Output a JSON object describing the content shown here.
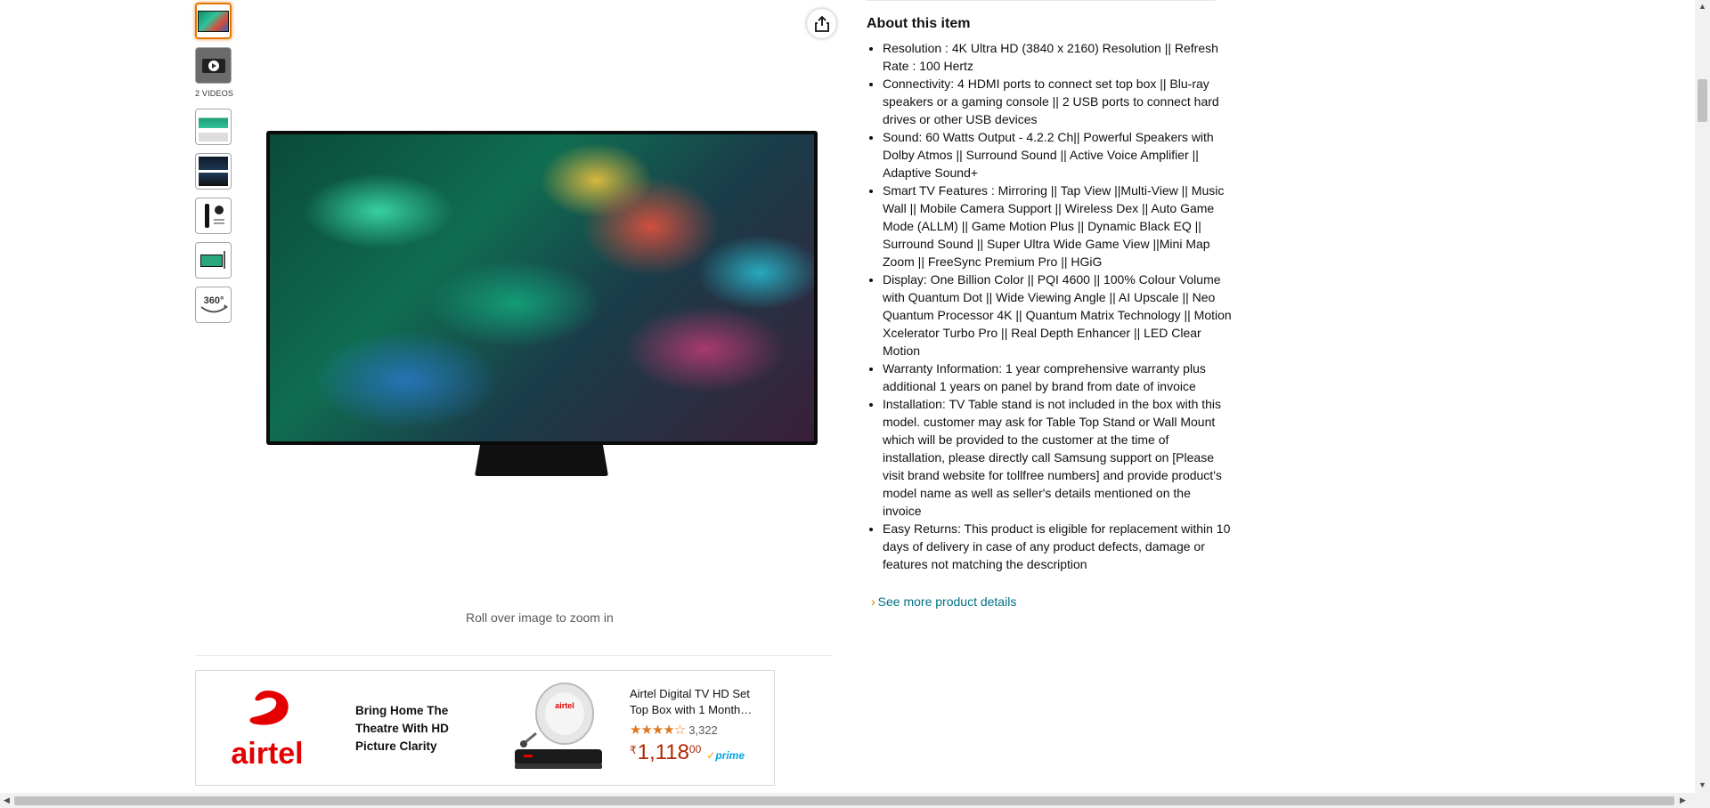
{
  "gallery": {
    "videos_label": "2 VIDEOS",
    "thumbnails": [
      "tv-front",
      "video",
      "tv-infographic",
      "tv-features",
      "remote-and-accessory",
      "tv-stand",
      "360-view"
    ],
    "thumb_360_label": "360°",
    "zoom_hint": "Roll over image to zoom in"
  },
  "about": {
    "title": "About this item",
    "bullets": [
      "Resolution : 4K Ultra HD (3840 x 2160) Resolution || Refresh Rate : 100 Hertz",
      "Connectivity: 4 HDMI ports to connect set top box || Blu-ray speakers or a gaming console || 2 USB ports to connect hard drives or other USB devices",
      "Sound: 60 Watts Output - 4.2.2 Ch|| Powerful Speakers with Dolby Atmos || Surround Sound || Active Voice Amplifier || Adaptive Sound+",
      "Smart TV Features : Mirroring || Tap View ||Multi-View || Music Wall || Mobile Camera Support || Wireless Dex || Auto Game Mode (ALLM) || Game Motion Plus || Dynamic Black EQ || Surround Sound || Super Ultra Wide Game View ||Mini Map Zoom || FreeSync Premium Pro || HGiG",
      "Display: One Billion Color || PQI 4600 || 100% Colour Volume with Quantum Dot || Wide Viewing Angle || AI Upscale || Neo Quantum Processor 4K || Quantum Matrix Technology || Motion Xcelerator Turbo Pro || Real Depth Enhancer || LED Clear Motion",
      "Warranty Information: 1 year comprehensive warranty plus additional 1 years on panel by brand from date of invoice",
      "Installation: TV Table stand is not included in the box with this model. customer may ask for Table Top Stand or Wall Mount which will be provided to the customer at the time of installation, please directly call Samsung support on [Please visit brand website for tollfree numbers] and provide product's model name as well as seller's details mentioned on the invoice",
      "Easy Returns: This product is eligible for replacement within 10 days of delivery in case of any product defects, damage or features not matching the description"
    ],
    "see_more": "See more product details"
  },
  "ad": {
    "brand": "airtel",
    "tagline": "Bring Home The Theatre With HD Picture Clarity",
    "product_title": "Airtel Digital TV HD Set Top Box with 1 Month…",
    "rating": 3.5,
    "rating_count": "3,322",
    "price_symbol": "₹",
    "price_whole": "1,118",
    "price_fraction": "00",
    "prime_label": "prime"
  },
  "colors": {
    "link": "#007185",
    "price": "#b12704",
    "star": "#de7921",
    "selected_border": "#e77600",
    "airtel_red": "#e40000"
  }
}
